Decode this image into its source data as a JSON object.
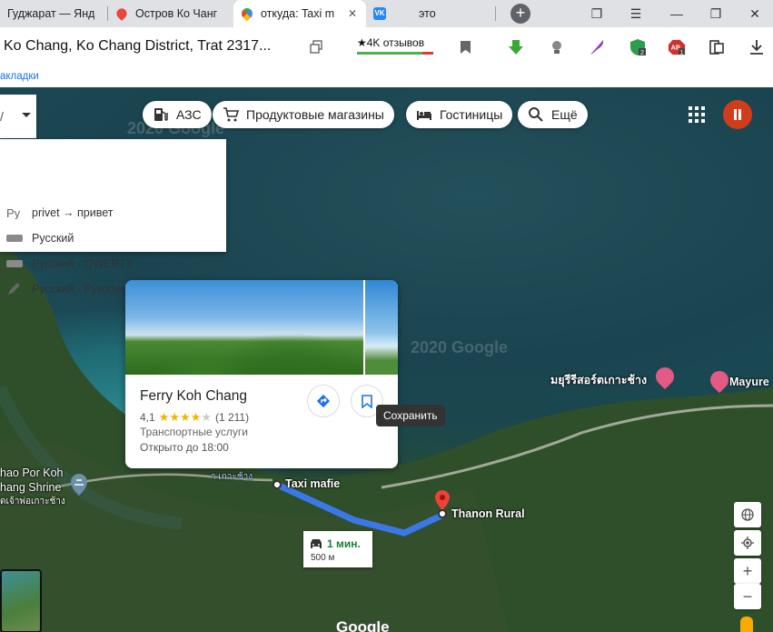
{
  "browser": {
    "tabs": [
      {
        "title": "Гуджарат — Янд",
        "icon": "yandex-icon"
      },
      {
        "title": "Остров Ко Чанг",
        "icon": "map-pin-icon"
      },
      {
        "title": "откуда: Taxi m",
        "icon": "google-maps-icon",
        "active": true
      },
      {
        "title": "это",
        "icon": "vk-icon"
      }
    ],
    "address": "Ko Chang, Ko Chang District, Trat 2317...",
    "reviews": "★4K отзывов",
    "bookmarks_label": "акладки"
  },
  "map": {
    "chips": [
      {
        "label": "АЗС",
        "icon": "gas-station-icon"
      },
      {
        "label": "Продуктовые магазины",
        "icon": "cart-icon"
      },
      {
        "label": "Гостиницы",
        "icon": "bed-icon"
      },
      {
        "label": "Ещё",
        "icon": "search-icon"
      }
    ],
    "ime_menu": [
      {
        "label": "privet → привет",
        "icon": "transliteration-icon"
      },
      {
        "label": "Русский",
        "icon": "keyboard-icon"
      },
      {
        "label": "Русский - QWERTY",
        "icon": "keyboard-icon"
      },
      {
        "label": "Русский - Рукописный ввод",
        "icon": "pencil-icon"
      }
    ],
    "place_card": {
      "name": "Ferry Koh Chang",
      "rating": "4,1",
      "stars": 4,
      "reviews": "(1 211)",
      "category": "Транспортные услуги",
      "hours": "Открыто до 18:00",
      "save_tooltip": "Сохранить"
    },
    "labels": {
      "taxi": "Taxi mafie",
      "thanon": "Thanon Rural",
      "resort_thai": "มยุรีรีสอร์ตเกาะช้าง",
      "mayure": "Mayure",
      "shrine_1": "hao Por Koh",
      "shrine_2": "hang Shrine",
      "shrine_thai": "ดเจ้าพ่อเกาะช้าง",
      "small_thai": "า เกาะช้าง"
    },
    "route": {
      "duration": "1 мин.",
      "distance": "500 м"
    },
    "watermarks": [
      "2020 Google",
      "2020 Google"
    ],
    "google_logo": "Google",
    "zoom_in": "+",
    "zoom_out": "−"
  }
}
